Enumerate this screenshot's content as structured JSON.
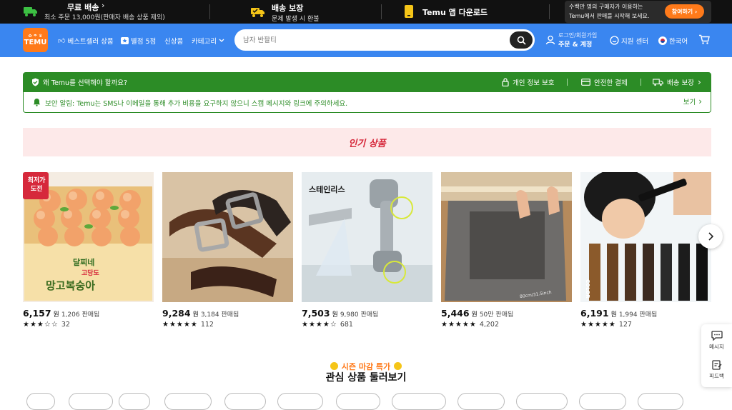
{
  "topbar": {
    "free_shipping_title": "무료 배송",
    "free_shipping_sub": "최소 주문 13,000원(판매자 배송 상품 제외)",
    "delivery_title": "배송 보장",
    "delivery_sub": "문제 발생 시 환불",
    "app_title": "Temu 앱 다운로드",
    "promo_line1": "수백만 명의 구매자가 이용하는",
    "promo_line2": "Temu에서 판매를 시작해 보세요.",
    "promo_button": "참여하기"
  },
  "nav": {
    "logo_text": "TEMU",
    "bestsellers": "베스트셀러 상품",
    "five_star": "별점 5점",
    "new_arrivals": "신상품",
    "categories": "카테고리",
    "search_placeholder": "남자 반팔티",
    "account_line1": "로그인/회원가입",
    "account_line2": "주문 & 계정",
    "support": "지원 센터",
    "language": "한국어"
  },
  "why": {
    "title": "왜 Temu를 선택해야 할까요?",
    "privacy": "개인 정보 보호",
    "payment": "안전한 결제",
    "delivery": "배송 보장",
    "alert": "보안 알림: Temu는 SMS나 이메일을 통해 추가 비용을 요구하지 않으니 스캠 메시지와 링크에 주의하세요.",
    "view": "보기"
  },
  "popular_title": "인기 상품",
  "products": [
    {
      "price": "6,157",
      "unit": "원",
      "sold": "1,206 판매됨",
      "stars": 3,
      "reviews": "32",
      "badge": "최저가 도전",
      "box_brand": "달찌네",
      "box_sub": "고당도",
      "box_name": "망고복숭아"
    },
    {
      "price": "9,284",
      "unit": "원",
      "sold": "3,184 판매됨",
      "stars": 5,
      "reviews": "112"
    },
    {
      "price": "7,503",
      "unit": "원",
      "sold": "9,980 판매됨",
      "stars": 4.5,
      "reviews": "681",
      "img_text": "스테인리스"
    },
    {
      "price": "5,446",
      "unit": "원",
      "sold": "50만 판매됨",
      "stars": 4.5,
      "reviews": "4,202",
      "mat_size": "80cm/31.5inch"
    },
    {
      "price": "6,191",
      "unit": "원",
      "sold": "1,994 판매됨",
      "stars": 4.5,
      "reviews": "127",
      "crayon_label": "COLOR"
    }
  ],
  "side": {
    "message": "메시지",
    "feedback": "피드백"
  },
  "season": {
    "tag": "시즌 마감 특가",
    "title": "관심 상품 둘러보기"
  },
  "colors": {
    "brand_orange": "#ff7a1a",
    "nav_blue": "#3a86f0",
    "trust_green": "#2c8c26",
    "popular_red": "#d6283b"
  }
}
